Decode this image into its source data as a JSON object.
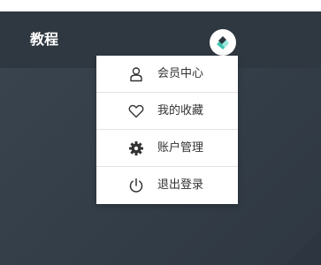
{
  "header": {
    "brand": "教程",
    "avatar_icon": "user-avatar-icon"
  },
  "menu": {
    "items": [
      {
        "label": "会员中心",
        "icon": "user-icon"
      },
      {
        "label": "我的收藏",
        "icon": "heart-icon"
      },
      {
        "label": "账户管理",
        "icon": "gear-icon"
      },
      {
        "label": "退出登录",
        "icon": "power-icon"
      }
    ]
  },
  "colors": {
    "background": "#353f49",
    "header": "#2f3841",
    "menu_bg": "#ffffff",
    "menu_text": "#333333",
    "icon": "#333333"
  }
}
